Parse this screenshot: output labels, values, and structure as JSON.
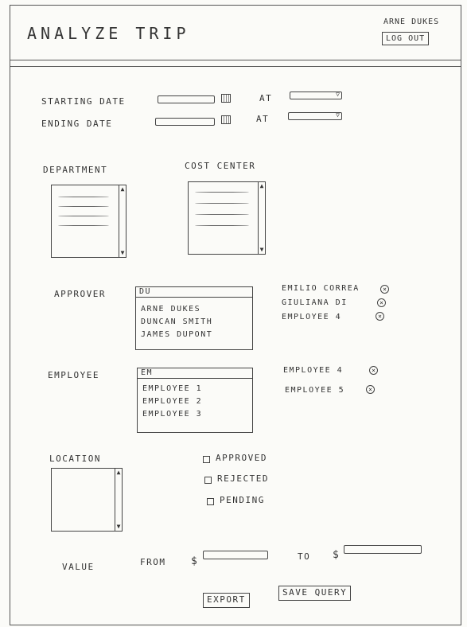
{
  "header": {
    "title": "ANALYZE TRIP",
    "user_name": "ARNE DUKES",
    "logout_label": "LOG OUT"
  },
  "dates": {
    "starting_label": "STARTING DATE",
    "ending_label": "ENDING DATE",
    "at_label": "AT",
    "dropdown_arrow": "▽",
    "calendar_glyph": "▦"
  },
  "department": {
    "label": "DEPARTMENT"
  },
  "cost_center": {
    "label": "COST CENTER"
  },
  "scroll": {
    "up": "▲",
    "down": "▼"
  },
  "approver": {
    "label": "APPROVER",
    "input_value": "DU",
    "suggestions": [
      "ARNE DUKES",
      "DUNCAN SMITH",
      "JAMES DUPONT"
    ],
    "selected": [
      "EMILIO CORREA",
      "GIULIANA DI",
      "EMPLOYEE 4"
    ]
  },
  "employee": {
    "label": "EMPLOYEE",
    "input_value": "EM",
    "suggestions": [
      "EMPLOYEE 1",
      "EMPLOYEE 2",
      "EMPLOYEE 3"
    ],
    "selected": [
      "EMPLOYEE 4",
      "EMPLOYEE 5"
    ]
  },
  "remove_glyph": "×",
  "location": {
    "label": "LOCATION"
  },
  "status": {
    "approved": "APPROVED",
    "rejected": "REJECTED",
    "pending": "PENDING"
  },
  "value": {
    "label": "VALUE",
    "from_label": "FROM",
    "to_label": "TO",
    "currency": "$"
  },
  "actions": {
    "export_label": "EXPORT",
    "save_query_label": "SAVE QUERY"
  }
}
